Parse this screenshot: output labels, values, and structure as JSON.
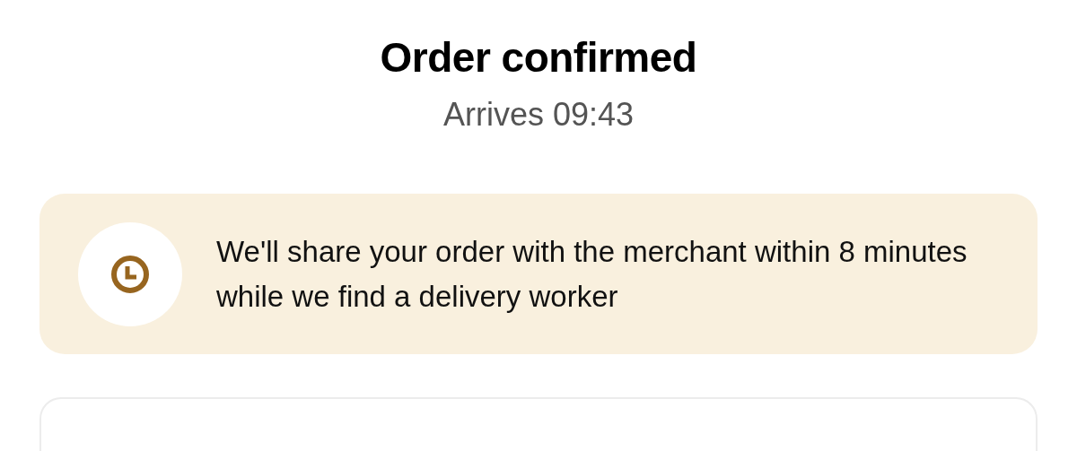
{
  "header": {
    "title": "Order confirmed",
    "subtitle": "Arrives 09:43"
  },
  "notice": {
    "message": "We'll share your order with the merchant within 8 minutes while we find a delivery worker"
  }
}
